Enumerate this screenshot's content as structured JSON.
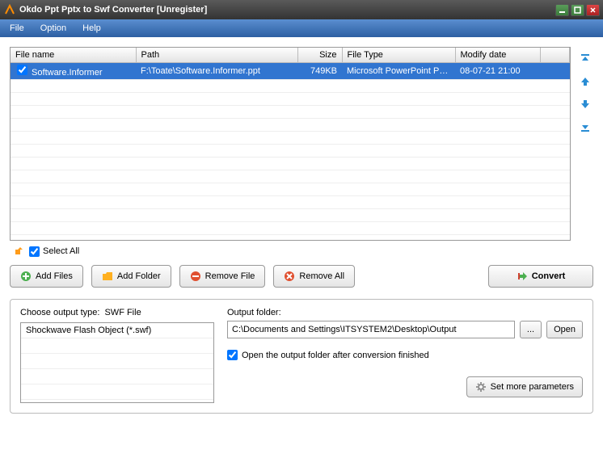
{
  "window": {
    "title": "Okdo Ppt Pptx to Swf Converter [Unregister]"
  },
  "menu": {
    "file": "File",
    "option": "Option",
    "help": "Help"
  },
  "table": {
    "headers": {
      "filename": "File name",
      "path": "Path",
      "size": "Size",
      "filetype": "File Type",
      "modify": "Modify date"
    },
    "rows": [
      {
        "checked": true,
        "filename": "Software.Informer",
        "path": "F:\\Toate\\Software.Informer.ppt",
        "size": "749KB",
        "filetype": "Microsoft PowerPoint Pre...",
        "modify": "08-07-21 21:00"
      }
    ]
  },
  "selectAll": "Select All",
  "buttons": {
    "addFiles": "Add Files",
    "addFolder": "Add Folder",
    "removeFile": "Remove File",
    "removeAll": "Remove All",
    "convert": "Convert"
  },
  "outputType": {
    "label": "Choose output type:",
    "value": "SWF File",
    "item": "Shockwave Flash Object (*.swf)"
  },
  "outputFolder": {
    "label": "Output folder:",
    "path": "C:\\Documents and Settings\\ITSYSTEM2\\Desktop\\Output",
    "browse": "...",
    "open": "Open",
    "openAfter": "Open the output folder after conversion finished",
    "moreParams": "Set more parameters"
  }
}
